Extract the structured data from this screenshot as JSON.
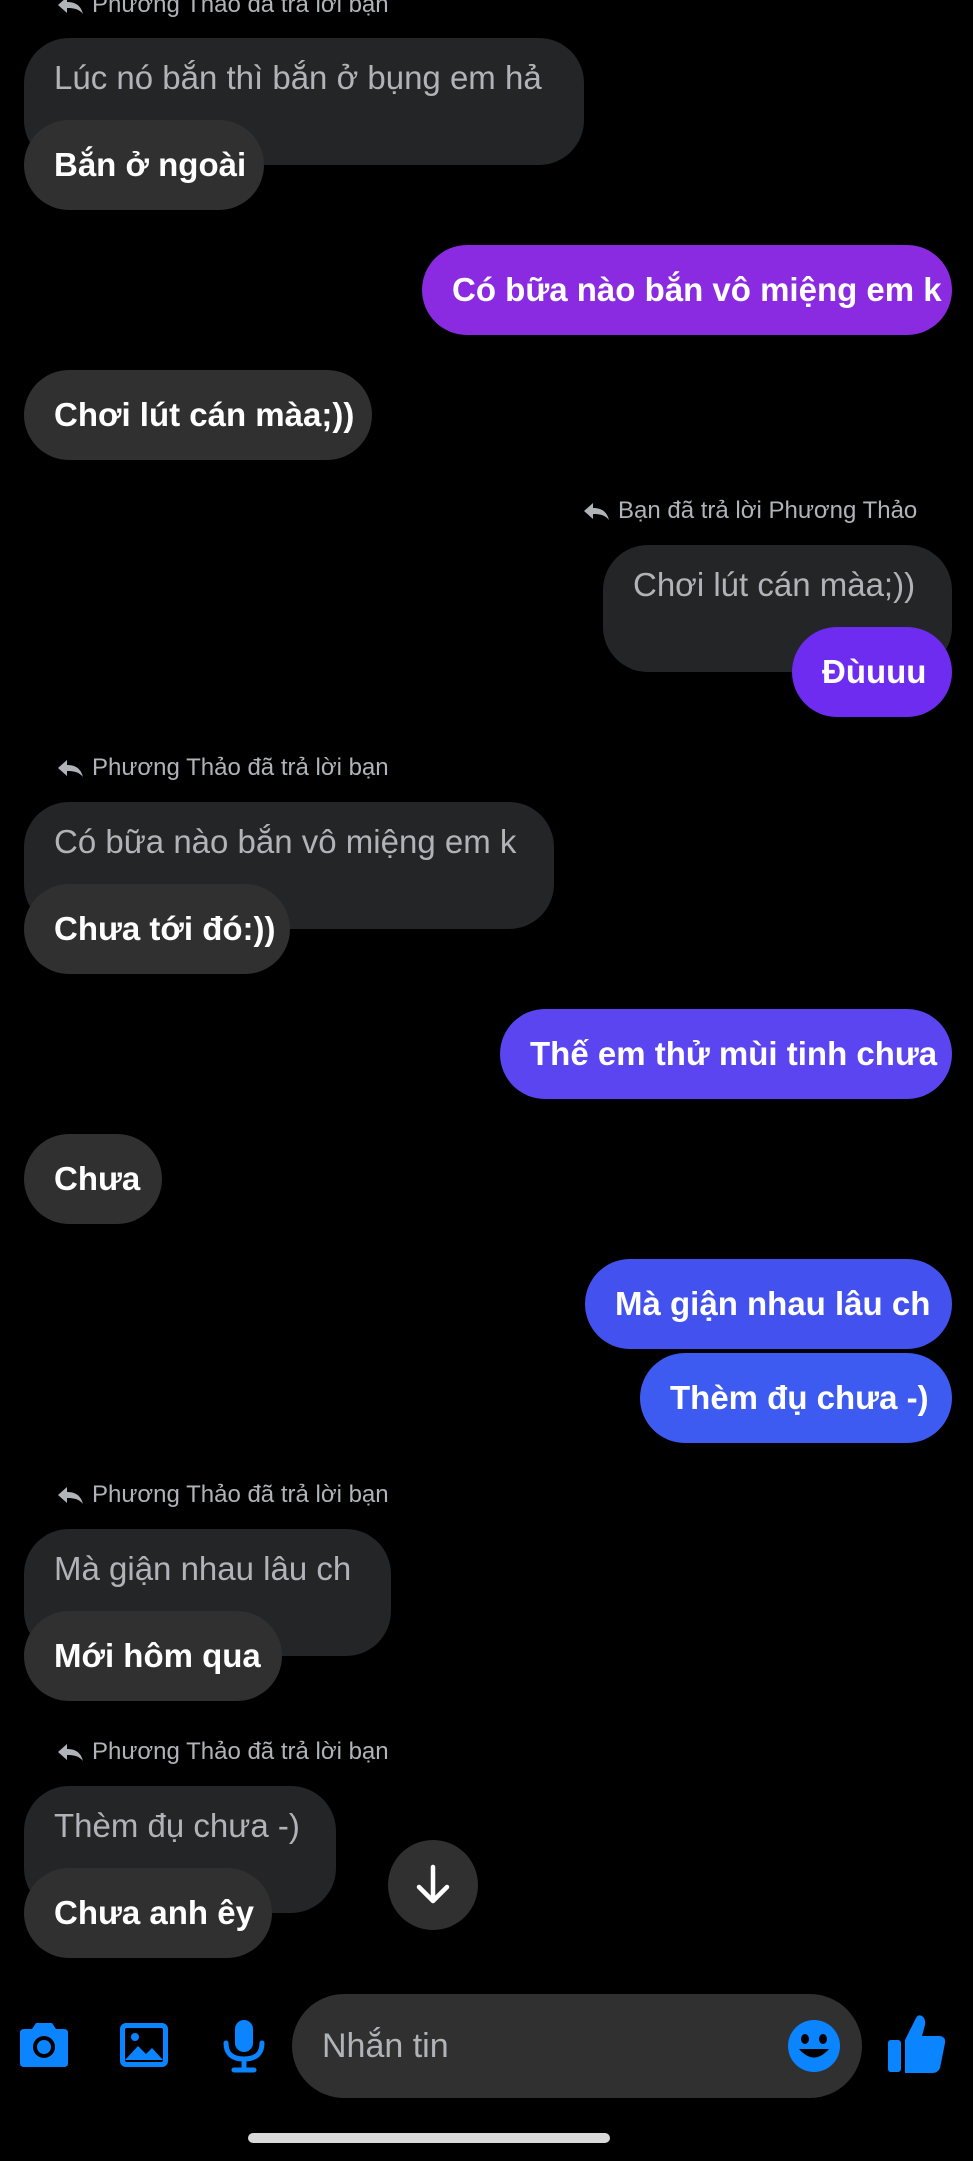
{
  "colors": {
    "incoming_bubble": "#303030",
    "quote_bubble": "#242526",
    "outgoing_purple": "#8a2be2",
    "outgoing_violet": "#6e2cf0",
    "outgoing_indigo": "#5b45f0",
    "outgoing_blue": "#3d5af1",
    "accent": "#0a84ff"
  },
  "messages": [
    {
      "reply_label": "Phương Thảo đã trả lời bạn",
      "quote": "Lúc nó bắn thì bắn ở bụng em hả",
      "text": "Bắn ở ngoài"
    },
    {
      "text": "Có bữa nào bắn vô miệng em k"
    },
    {
      "text": "Chơi lút cán màa;))"
    },
    {
      "reply_label": "Bạn đã trả lời Phương Thảo",
      "quote": "Chơi lút cán màa;))",
      "text": "Đùuuu"
    },
    {
      "reply_label": "Phương Thảo đã trả lời bạn",
      "quote": "Có bữa nào bắn vô miệng em k",
      "text": "Chưa tới đó:))"
    },
    {
      "text": "Thế em thử mùi tinh chưa"
    },
    {
      "text": "Chưa"
    },
    {
      "text": "Mà giận nhau lâu ch"
    },
    {
      "text": "Thèm đụ chưa -)"
    },
    {
      "reply_label": "Phương Thảo đã trả lời bạn",
      "quote": "Mà giận nhau lâu ch",
      "text": "Mới hôm qua"
    },
    {
      "reply_label": "Phương Thảo đã trả lời bạn",
      "quote": "Thèm đụ chưa -)",
      "text": "Chưa anh êy"
    }
  ],
  "composer": {
    "placeholder": "Nhắn tin",
    "icons": [
      "camera-icon",
      "image-icon",
      "microphone-icon",
      "emoji-icon",
      "thumbs-up-icon"
    ]
  },
  "scroll_down_icon": "arrow-down-icon"
}
